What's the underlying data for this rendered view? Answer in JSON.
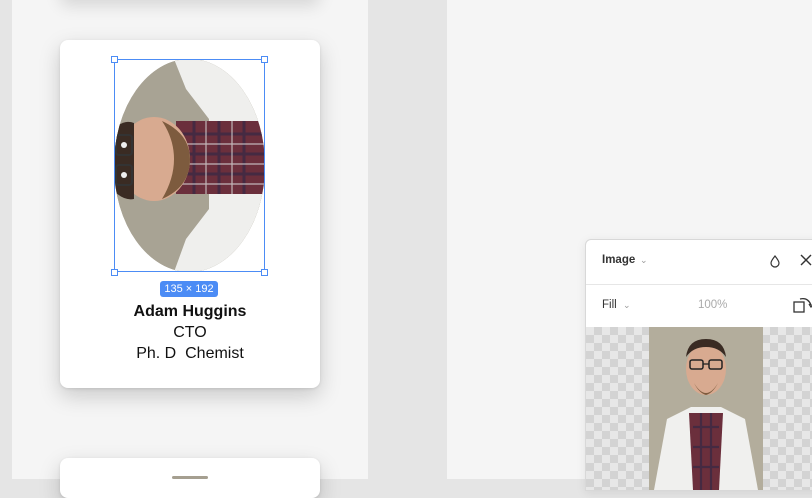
{
  "card": {
    "name": "Adam Huggins",
    "role": "CTO",
    "degree": "Ph. D  Chemist"
  },
  "selection": {
    "dimensions": "135 × 192"
  },
  "image_panel": {
    "title": "Image",
    "fill_mode": "Fill",
    "opacity": "100%"
  },
  "icons": {
    "title_chevron": "chevron-down-icon",
    "drop": "drop-icon",
    "close": "close-icon",
    "fill_chevron": "chevron-down-icon",
    "rotate": "rotate-icon"
  },
  "colors": {
    "selection": "#4c8cf5",
    "canvas": "#f5f5f5",
    "workspace": "#e5e5e5"
  }
}
